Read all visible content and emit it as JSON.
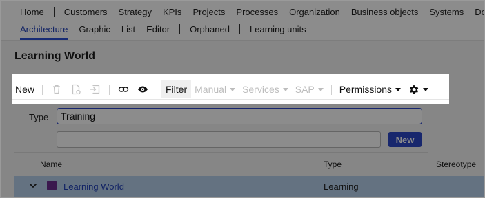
{
  "nav": {
    "primary": [
      "Home",
      "Customers",
      "Strategy",
      "KPIs",
      "Projects",
      "Processes",
      "Organization",
      "Business objects",
      "Systems",
      "Docu"
    ],
    "secondary": [
      "Architecture",
      "Graphic",
      "List",
      "Editor",
      "Orphaned",
      "Learning units"
    ],
    "active_secondary": "Architecture"
  },
  "page": {
    "title": "Learning World"
  },
  "toolbar": {
    "new_label": "New",
    "filter_label": "Filter",
    "manual_label": "Manual",
    "services_label": "Services",
    "sap_label": "SAP",
    "permissions_label": "Permissions"
  },
  "form": {
    "type_label": "Type",
    "type_value": "Training",
    "name_value": "",
    "new_button": "New"
  },
  "table": {
    "headers": {
      "name": "Name",
      "type": "Type",
      "stereotype": "Stereotype"
    },
    "rows": [
      {
        "name": "Learning World",
        "type": "Learning",
        "color": "#6a2c8f"
      }
    ]
  },
  "colors": {
    "accent": "#2c47c6",
    "selected_row": "#b7d0ec"
  }
}
